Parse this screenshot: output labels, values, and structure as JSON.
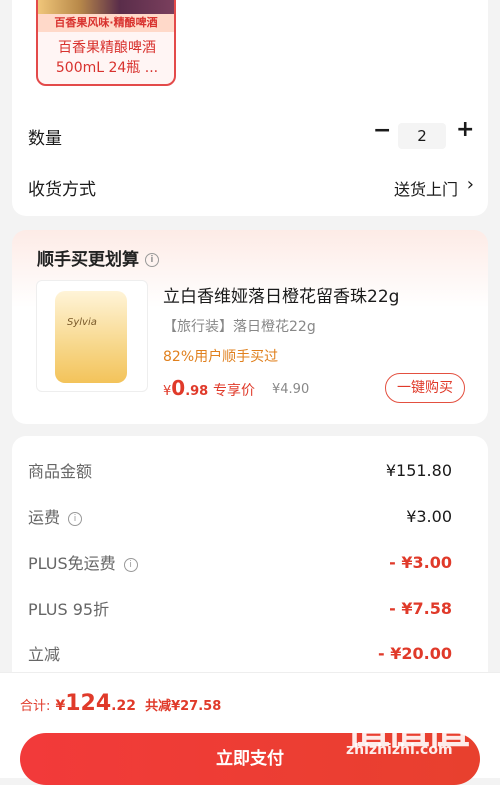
{
  "product": {
    "thumb_banner": "百香果风味·精酿啤酒",
    "title_line1": "百香果精酿啤酒",
    "title_line2": "500mL 24瓶 ..."
  },
  "quantity": {
    "label": "数量",
    "value": "2",
    "minus": "−",
    "plus": "+"
  },
  "delivery": {
    "label": "收货方式",
    "value": "送货上门",
    "chevron": "›"
  },
  "upsell": {
    "title": "顺手买更划算",
    "info": "i",
    "brand": "Sylvia",
    "name": "立白香维娅落日橙花留香珠22g",
    "spec": "【旅行装】落日橙花22g",
    "rate": "82%用户顺手买过",
    "price_currency": "¥",
    "price_int": "0",
    "price_dec": ".98",
    "exclusive_label": "专享价",
    "original_price": "¥4.90",
    "buy_label": "一键购买"
  },
  "fees": [
    {
      "label": "商品金额",
      "value": "¥151.80",
      "info": false,
      "red": false
    },
    {
      "label": "运费",
      "value": "¥3.00",
      "info": true,
      "red": false
    },
    {
      "label": "PLUS免运费",
      "value": "- ¥3.00",
      "info": true,
      "red": true
    },
    {
      "label": "PLUS 95折",
      "value": "- ¥7.58",
      "info": false,
      "red": true
    },
    {
      "label": "立减",
      "value": "- ¥20.00",
      "info": false,
      "red": true
    }
  ],
  "bottom": {
    "total_label": "合计:",
    "total_currency": "¥",
    "total_int": "124",
    "total_dec": ".22",
    "saved": "共减¥27.58",
    "pay_label": "立即支付"
  },
  "watermark": {
    "glyphs": "值值值",
    "url": "zhizhizhi.com"
  },
  "colors": {
    "accent_red": "#e03a2a",
    "pay_button": "#f23a3a",
    "upsell_orange": "#e0801e"
  }
}
